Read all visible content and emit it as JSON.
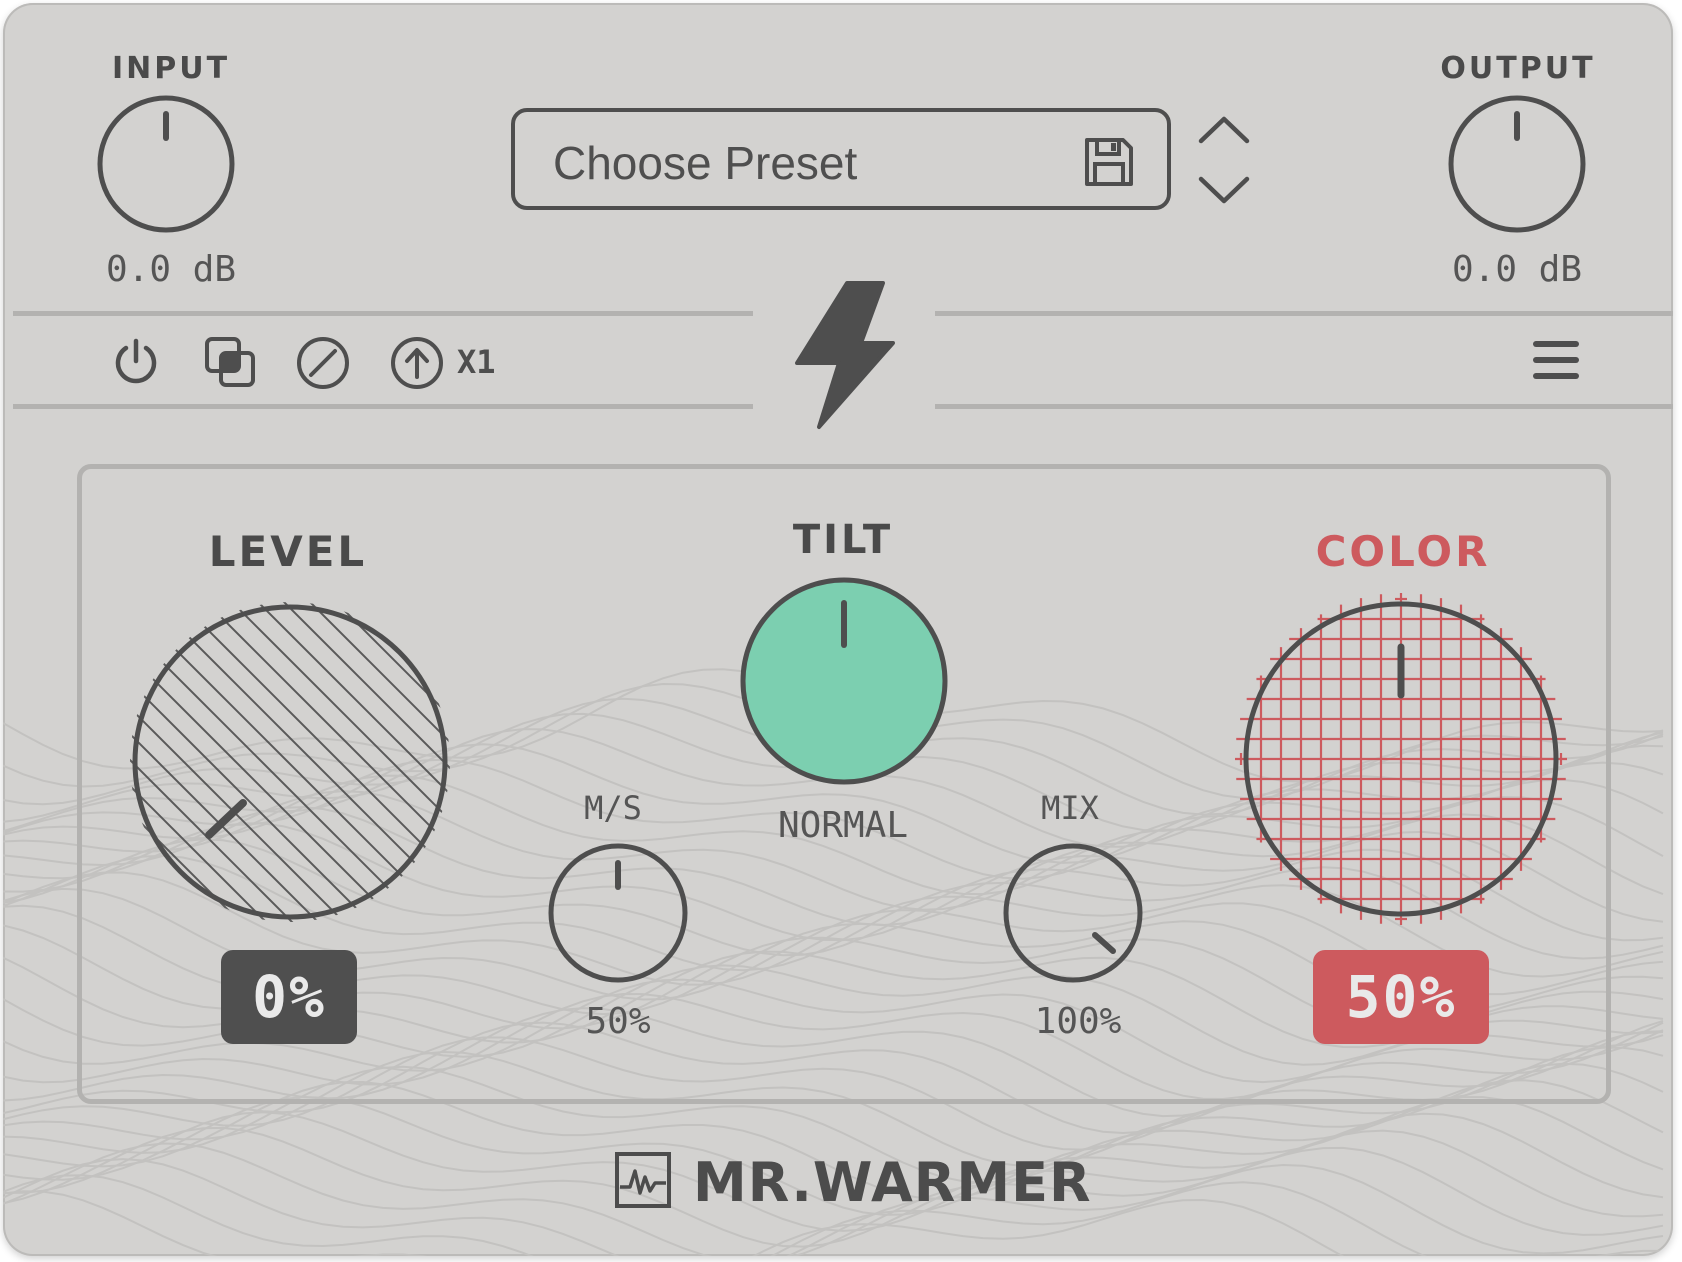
{
  "plugin": {
    "name": "MR.WARMER"
  },
  "header": {
    "input": {
      "label": "INPUT",
      "value": "0.0 dB"
    },
    "output": {
      "label": "OUTPUT",
      "value": "0.0 dB"
    },
    "preset": {
      "label": "Choose Preset"
    }
  },
  "toolbar": {
    "oversampling_label": "X1",
    "icons": [
      "power-icon",
      "compare-icon",
      "bypass-icon",
      "upsample-icon",
      "lightning-icon",
      "menu-icon"
    ]
  },
  "knobs": {
    "level": {
      "label": "LEVEL",
      "value": "0%"
    },
    "tilt": {
      "label": "TILT",
      "value": "NORMAL"
    },
    "color": {
      "label": "COLOR",
      "value": "50%"
    },
    "ms": {
      "label": "M/S",
      "value": "50%"
    },
    "mix": {
      "label": "MIX",
      "value": "100%"
    }
  },
  "colors": {
    "background": "#d3d2d0",
    "ink": "#4e4e4e",
    "tilt_fill": "#7ccfb0",
    "color_accent": "#cd5a5e",
    "level_badge": "#4f4f4f"
  }
}
